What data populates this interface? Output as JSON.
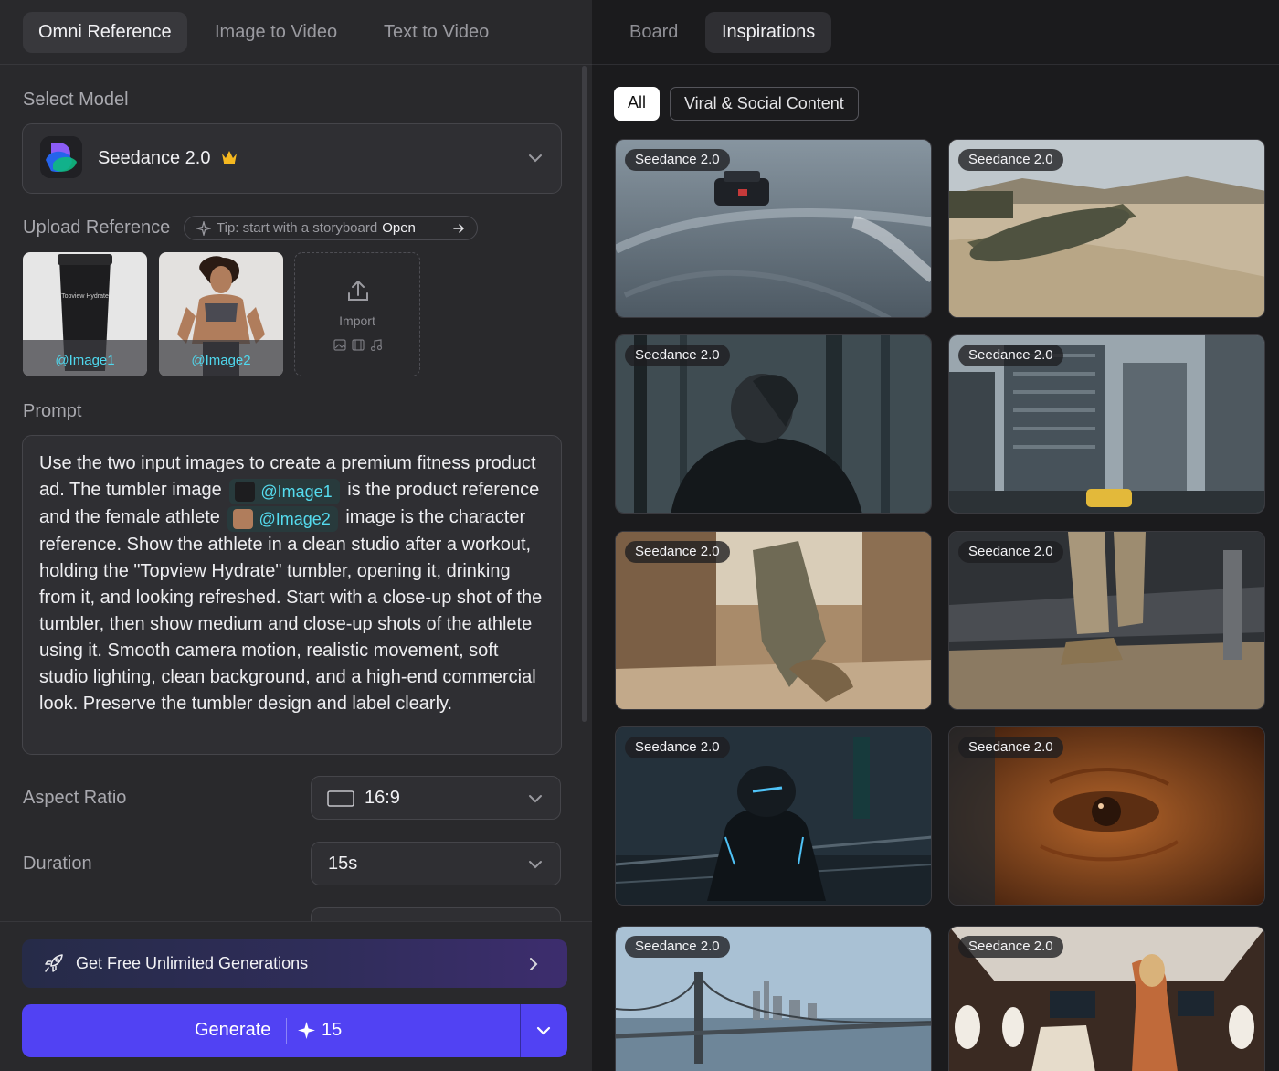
{
  "left_tabs": [
    "Omni Reference",
    "Image to Video",
    "Text to Video"
  ],
  "select_model": {
    "label": "Select Model",
    "model_name": "Seedance 2.0",
    "crown_icon": "crown-icon"
  },
  "upload": {
    "label": "Upload Reference",
    "tip_text": "Tip: start with a storyboard",
    "tip_link": "Open",
    "images": [
      {
        "tag": "@Image1",
        "printed_text": "Topview Hydrate"
      },
      {
        "tag": "@Image2"
      }
    ],
    "import_label": "Import"
  },
  "prompt": {
    "label": "Prompt",
    "part1": "Use the two input images to create a premium fitness product ad. The tumbler image",
    "chip1": "@Image1",
    "part2": "is the product reference and the female athlete",
    "chip2": "@Image2",
    "part3": "image is the character reference. Show the athlete in a clean studio after a workout, holding the \"Topview Hydrate\" tumbler, opening it, drinking from it, and looking refreshed. Start with a close-up shot of the tumbler, then show medium and close-up shots of the athlete using it. Smooth camera motion, realistic movement, soft studio lighting, clean background, and a high-end commercial look. Preserve the tumbler design and label clearly."
  },
  "aspect_ratio": {
    "label": "Aspect Ratio",
    "value": "16:9"
  },
  "duration": {
    "label": "Duration",
    "value": "15s"
  },
  "promo": {
    "text": "Get Free Unlimited Generations"
  },
  "generate": {
    "label": "Generate",
    "credits": "15"
  },
  "right_tabs": [
    "Board",
    "Inspirations"
  ],
  "filters": [
    "All",
    "Viral & Social Content"
  ],
  "gallery": [
    {
      "badge": "Seedance 2.0",
      "scene": "race-car-wet-track"
    },
    {
      "badge": "Seedance 2.0",
      "scene": "tank-desert"
    },
    {
      "badge": "Seedance 2.0",
      "scene": "man-dark-forest"
    },
    {
      "badge": "Seedance 2.0",
      "scene": "city-skyscrapers-taxi"
    },
    {
      "badge": "Seedance 2.0",
      "scene": "soldier-desert-alley"
    },
    {
      "badge": "Seedance 2.0",
      "scene": "soldier-boots-hangar"
    },
    {
      "badge": "Seedance 2.0",
      "scene": "cyber-ninja-rain"
    },
    {
      "badge": "Seedance 2.0",
      "scene": "eye-closeup"
    },
    {
      "badge": "Seedance 2.0",
      "scene": "bridge-skyline"
    },
    {
      "badge": "Seedance 2.0",
      "scene": "private-jet-cabin"
    }
  ],
  "colors": {
    "accent": "#5142f3",
    "chip_text": "#55dcef",
    "panel": "#29292c",
    "background": "#1b1b1d"
  }
}
